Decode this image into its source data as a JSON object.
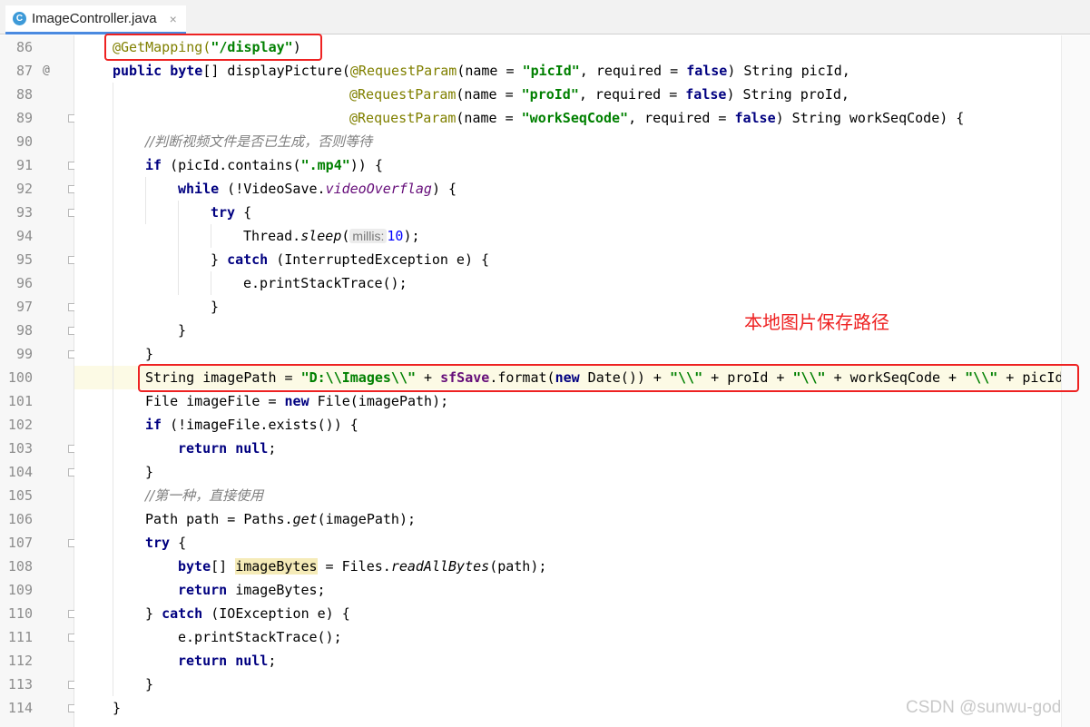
{
  "tab": {
    "icon_letter": "C",
    "filename": "ImageController.java",
    "close": "×"
  },
  "gutter": {
    "line_numbers": [
      "86",
      "87",
      "88",
      "89",
      "90",
      "91",
      "92",
      "93",
      "94",
      "95",
      "96",
      "97",
      "98",
      "99",
      "100",
      "101",
      "102",
      "103",
      "104",
      "105",
      "106",
      "107",
      "108",
      "109",
      "110",
      "111",
      "112",
      "113",
      "114"
    ],
    "override_marker": "@"
  },
  "code": {
    "l86": [
      "@GetMapping(",
      "\"/display\"",
      ")"
    ],
    "l87": [
      "public byte",
      "[] displayPicture(",
      "@RequestParam",
      "(name = ",
      "\"picId\"",
      ", required = ",
      "false",
      ") String picId,"
    ],
    "l88": [
      "@RequestParam",
      "(name = ",
      "\"proId\"",
      ", required = ",
      "false",
      ") String proId,"
    ],
    "l89": [
      "@RequestParam",
      "(name = ",
      "\"workSeqCode\"",
      ", required = ",
      "false",
      ") String workSeqCode) {"
    ],
    "l90": [
      "//判断视频文件是否已生成，否则等待"
    ],
    "l91": [
      "if",
      " (picId.contains(",
      "\".mp4\"",
      ")) {"
    ],
    "l92": [
      "while",
      " (!VideoSave.",
      "videoOverflag",
      ") {"
    ],
    "l93": [
      "try",
      " {"
    ],
    "l94": [
      "Thread.",
      "sleep",
      "(",
      "millis:",
      "10",
      ");"
    ],
    "l95": [
      "} ",
      "catch",
      " (InterruptedException e) {"
    ],
    "l96": [
      "e.printStackTrace();"
    ],
    "l97": [
      "}"
    ],
    "l98": [
      "}"
    ],
    "l99": [
      "}"
    ],
    "l100": [
      "String imagePath = ",
      "\"D:\\\\Images\\\\\"",
      " + ",
      "sfSave",
      ".format(",
      "new",
      " Date()) + ",
      "\"\\\\\"",
      " + proId + ",
      "\"\\\\\"",
      " + workSeqCode + ",
      "\"\\\\\"",
      " + picId;"
    ],
    "l101": [
      "File imageFile = ",
      "new",
      " File(imagePath);"
    ],
    "l102": [
      "if",
      " (!imageFile.exists()) {"
    ],
    "l103": [
      "return null",
      ";"
    ],
    "l104": [
      "}"
    ],
    "l105": [
      "//第一种，直接使用"
    ],
    "l106": [
      "Path path = Paths.",
      "get",
      "(imagePath);"
    ],
    "l107": [
      "try",
      " {"
    ],
    "l108": [
      "byte",
      "[] ",
      "imageBytes",
      " = Files.",
      "readAllBytes",
      "(path);"
    ],
    "l109": [
      "return",
      " imageBytes;"
    ],
    "l110": [
      "} ",
      "catch",
      " (IOException e) {"
    ],
    "l111": [
      "e.printStackTrace();"
    ],
    "l112": [
      "return null",
      ";"
    ],
    "l113": [
      "}"
    ],
    "l114": [
      "}"
    ]
  },
  "annotation_note": "本地图片保存路径",
  "watermark": "CSDN @sunwu-god",
  "colors": {
    "keyword": "#000080",
    "string": "#008000",
    "annotation": "#808000",
    "comment": "#808080",
    "highlight_box": "#ee2222"
  }
}
